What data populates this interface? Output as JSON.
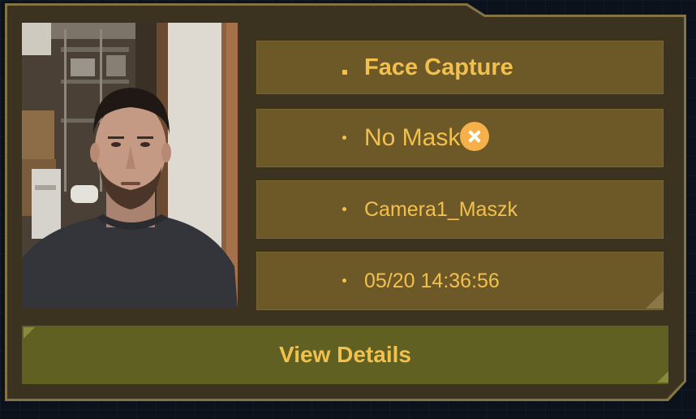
{
  "capture": {
    "title": "Face Capture",
    "mask_status": "No Mask",
    "mask_status_icon": "close-circle-icon",
    "camera": "Camera1_Maszk",
    "timestamp": "05/20 14:36:56"
  },
  "actions": {
    "view_details_label": "View Details"
  },
  "colors": {
    "accent": "#f2c04c",
    "card_background": "#3b321f",
    "row_background": "#6d5928",
    "button_background": "#5f6021",
    "status_icon": "#f6b04a"
  }
}
